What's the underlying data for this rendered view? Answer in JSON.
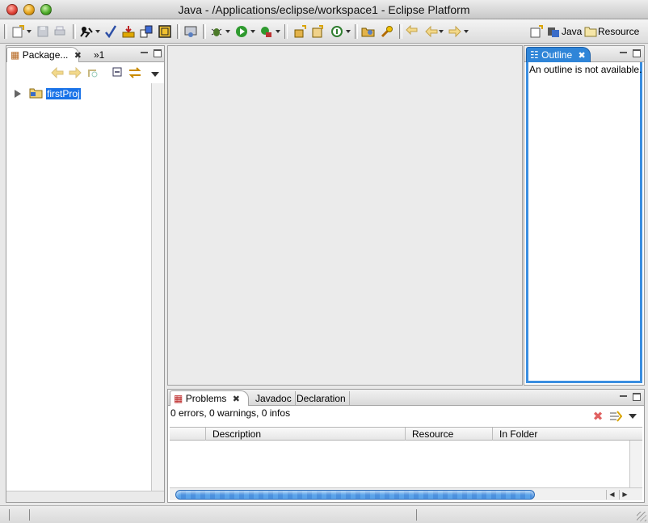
{
  "window": {
    "title": "Java - /Applications/eclipse/workspace1 - Eclipse Platform"
  },
  "toolbar": {
    "icons": [
      "new-wizard-icon",
      "save-icon",
      "print-icon",
      "run-ant-icon",
      "check-icon",
      "build-icon",
      "jar-icon",
      "frame-icon",
      "server-icon",
      "debug-icon",
      "run-icon",
      "external-tools-icon",
      "open-type-icon",
      "new-package-icon",
      "new-class-icon",
      "open-folder-icon",
      "search-icon",
      "last-edit-icon",
      "back-icon",
      "forward-icon"
    ],
    "perspectives": {
      "java_label": "Java",
      "resource_label": "Resource"
    }
  },
  "package_explorer": {
    "tab_label": "Package...",
    "overflow_label": "»1",
    "tree": [
      {
        "label": "firstProj",
        "expanded": false,
        "selected": true
      }
    ]
  },
  "outline": {
    "tab_label": "Outline",
    "message": "An outline is not available."
  },
  "problems": {
    "tabs": [
      {
        "label": "Problems",
        "active": true
      },
      {
        "label": "Javadoc",
        "active": false
      },
      {
        "label": "Declaration",
        "active": false
      }
    ],
    "summary": "0 errors, 0 warnings, 0 infos",
    "columns": [
      "",
      "Description",
      "Resource",
      "In Folder"
    ],
    "rows": []
  },
  "colors": {
    "selection": "#1a73e8",
    "outline_accent": "#3a8ee0",
    "editor_bg": "#ebebeb"
  }
}
